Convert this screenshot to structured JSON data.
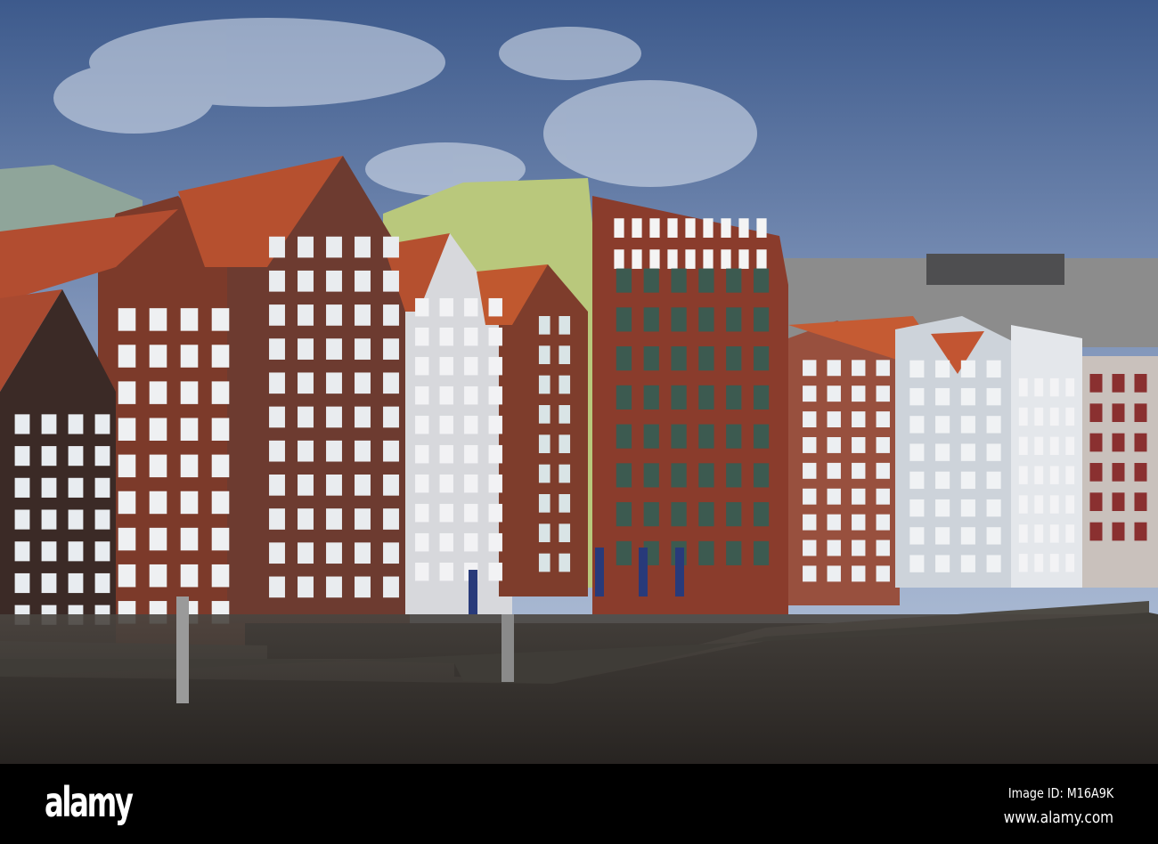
{
  "watermark": {
    "logo": "alamy",
    "image_id": "Image ID: M16A9K",
    "website": "www.alamy.com"
  },
  "scene": {
    "description_colors": {
      "sky_top": "#3d5a8c",
      "sky_bottom": "#9fb2d0",
      "water": "#38332f",
      "brick": "#7e3a2a",
      "roof": "#b9502f"
    }
  }
}
